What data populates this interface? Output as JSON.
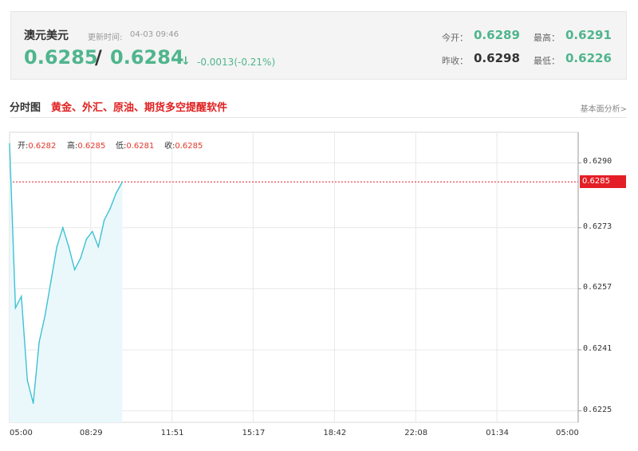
{
  "quote": {
    "name": "澳元美元",
    "update_label": "更新时间:",
    "update_time": "04-03 09:46",
    "bid": "0.6285",
    "separator": "/",
    "ask": "0.6284",
    "arrow": "↓",
    "change": "-0.0013(-0.21%)",
    "open_label": "今开：",
    "open_value": "0.6289",
    "high_label": "最高：",
    "high_value": "0.6291",
    "prev_close_label": "昨收：",
    "prev_close_value": "0.6298",
    "low_label": "最低：",
    "low_value": "0.6226"
  },
  "section": {
    "title": "分时图",
    "promo_link": "黄金、外汇、原油、期货多空提醒软件",
    "analysis_link": "基本面分析>"
  },
  "ohlc": {
    "open_label": "开:",
    "open_value": "0.6282",
    "high_label": "高:",
    "high_value": "0.6285",
    "low_label": "低:",
    "low_value": "0.6281",
    "close_label": "收:",
    "close_value": "0.6285"
  },
  "colors": {
    "up_down_green": "#4fb58d",
    "line": "#3ec1d3",
    "area": "#eaf8fc",
    "current_price": "#e41e26"
  },
  "chart_data": {
    "type": "line",
    "x_ticks": [
      "05:00",
      "08:29",
      "11:51",
      "15:17",
      "18:42",
      "22:08",
      "01:34",
      "05:00"
    ],
    "y_ticks": [
      "0.6290",
      "0.6273",
      "0.6257",
      "0.6241",
      "0.6225"
    ],
    "ylim": [
      0.6222,
      0.6298
    ],
    "current_price": "0.6285",
    "grid": true,
    "x": [
      "05:00",
      "05:15",
      "05:30",
      "05:45",
      "06:00",
      "06:15",
      "06:30",
      "06:45",
      "07:00",
      "07:15",
      "07:30",
      "07:45",
      "08:00",
      "08:15",
      "08:30",
      "08:45",
      "09:00",
      "09:15",
      "09:30",
      "09:46"
    ],
    "values": [
      0.6295,
      0.6252,
      0.6255,
      0.6233,
      0.6227,
      0.6243,
      0.625,
      0.6259,
      0.6268,
      0.6273,
      0.6268,
      0.6262,
      0.6265,
      0.627,
      0.6272,
      0.6268,
      0.6275,
      0.6278,
      0.6282,
      0.6285
    ]
  }
}
